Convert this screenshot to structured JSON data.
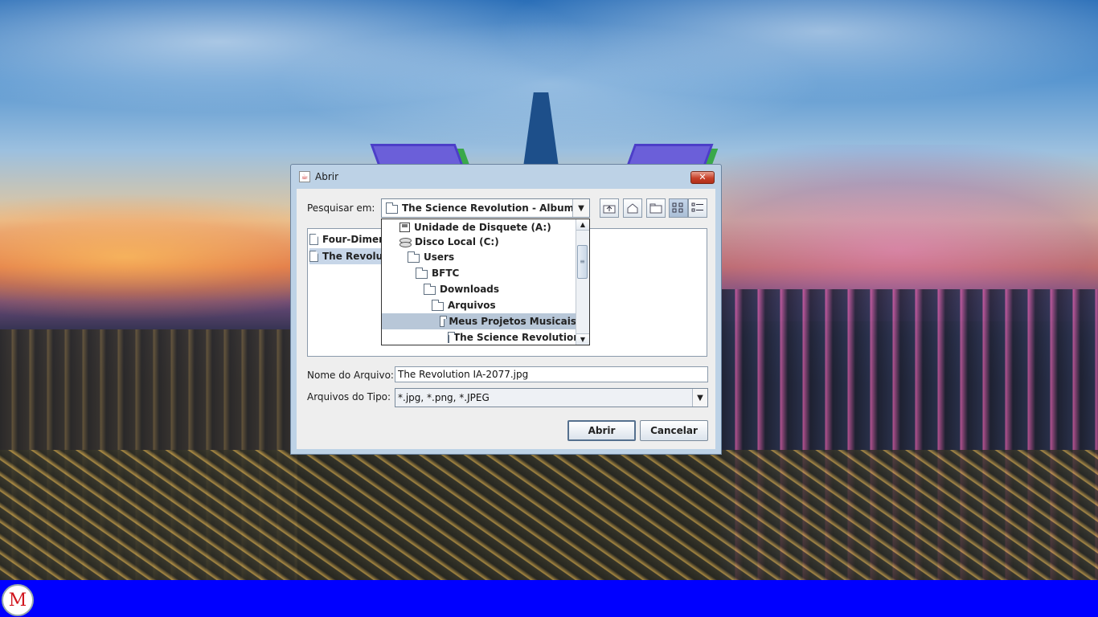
{
  "dialog": {
    "title": "Abrir",
    "close_label": "✕",
    "lookin_label": "Pesquisar em:",
    "lookin_value": "The Science Revolution - Album",
    "files": [
      {
        "name": "Four-Dimens",
        "selected": false
      },
      {
        "name": "The Revolutio",
        "selected": true
      }
    ],
    "dropdown_items": [
      {
        "label": "Unidade de Disquete (A:)",
        "icon": "floppy-drive-icon",
        "selected": false
      },
      {
        "label": "Disco Local (C:)",
        "icon": "hard-disk-icon",
        "selected": false
      },
      {
        "label": "Users",
        "icon": "folder-icon",
        "selected": false
      },
      {
        "label": "BFTC",
        "icon": "folder-icon",
        "selected": false
      },
      {
        "label": "Downloads",
        "icon": "folder-icon",
        "selected": false
      },
      {
        "label": "Arquivos",
        "icon": "folder-icon",
        "selected": false
      },
      {
        "label": "Meus Projetos Musicais",
        "icon": "folder-icon",
        "selected": true
      },
      {
        "label": "The Science Revolution -",
        "icon": "folder-icon",
        "selected": false
      }
    ],
    "filename_label": "Nome do Arquivo:",
    "filename_value": "The Revolution IA-2077.jpg",
    "filetype_label": "Arquivos do Tipo:",
    "filetype_value": "*.jpg, *.png, *.JPEG",
    "open_button": "Abrir",
    "cancel_button": "Cancelar"
  },
  "taskbar": {
    "start_logo": "M"
  },
  "colors": {
    "taskbar": "#0000ff",
    "dialog_frame": "#bdd2e6",
    "selection": "#c7d6e8"
  }
}
